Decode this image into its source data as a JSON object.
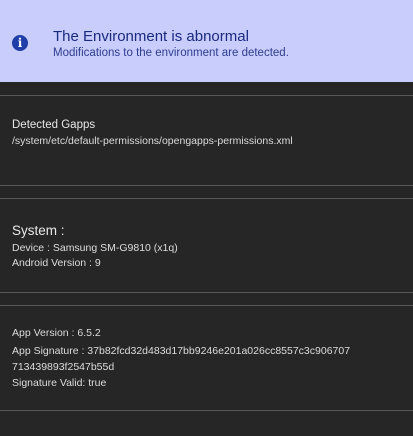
{
  "alert": {
    "icon": "info-icon",
    "title": "The Environment is abnormal",
    "message": "Modifications to the environment are detected.",
    "background": "#c9cdfb",
    "icon_color": "#1f3ea8"
  },
  "gapps": {
    "label": "Detected Gapps",
    "path": "/system/etc/default-permissions/opengapps-permissions.xml"
  },
  "system": {
    "header": "System :",
    "device": "Device : Samsung SM-G9810  (x1q)",
    "android_version": "Android Version : 9"
  },
  "app": {
    "version": "App Version : 6.5.2",
    "signature_line1": "App Signature : 37b82fcd32d483d17bb9246e201a026cc8557c3c906707",
    "signature_line2": "713439893f2547b55d",
    "signature_valid": "Signature Valid: true"
  }
}
